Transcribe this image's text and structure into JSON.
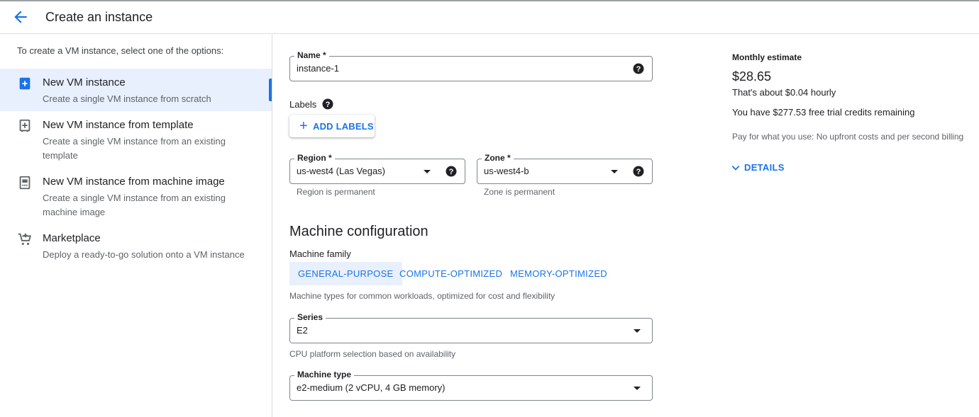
{
  "header": {
    "title": "Create an instance",
    "back_icon": "arrow-back-icon"
  },
  "left": {
    "intro": "To create a VM instance, select one of the options:",
    "options": [
      {
        "title": "New VM instance",
        "desc": "Create a single VM instance from scratch",
        "icon": "add-box-icon",
        "selected": true
      },
      {
        "title": "New VM instance from template",
        "desc": "Create a single VM instance from an existing template",
        "icon": "template-icon",
        "selected": false
      },
      {
        "title": "New VM instance from machine image",
        "desc": "Create a single VM instance from an existing machine image",
        "icon": "machine-image-icon",
        "selected": false
      },
      {
        "title": "Marketplace",
        "desc": "Deploy a ready-to-go solution onto a VM instance",
        "icon": "cart-icon",
        "selected": false
      }
    ]
  },
  "form": {
    "name": {
      "label": "Name *",
      "value": "instance-1"
    },
    "labels": {
      "title": "Labels",
      "add_button": "ADD LABELS"
    },
    "region": {
      "label": "Region *",
      "value": "us-west4 (Las Vegas)",
      "hint": "Region is permanent"
    },
    "zone": {
      "label": "Zone *",
      "value": "us-west4-b",
      "hint": "Zone is permanent"
    },
    "machine_config": {
      "title": "Machine configuration",
      "family_title": "Machine family",
      "tabs": [
        "GENERAL-PURPOSE",
        "COMPUTE-OPTIMIZED",
        "MEMORY-OPTIMIZED"
      ],
      "active_tab": 0,
      "family_desc": "Machine types for common workloads, optimized for cost and flexibility",
      "series": {
        "label": "Series",
        "value": "E2",
        "hint": "CPU platform selection based on availability"
      },
      "machine_type": {
        "label": "Machine type",
        "value": "e2-medium (2 vCPU, 4 GB memory)"
      }
    }
  },
  "estimate": {
    "title": "Monthly estimate",
    "price": "$28.65",
    "hourly": "That's about $0.04 hourly",
    "credits": "You have $277.53 free trial credits remaining",
    "pay": "Pay for what you use: No upfront costs and per second billing",
    "details": "DETAILS"
  },
  "colors": {
    "accent": "#1a73e8",
    "selected_bg": "#e8f0fe",
    "border": "#dadce0"
  }
}
